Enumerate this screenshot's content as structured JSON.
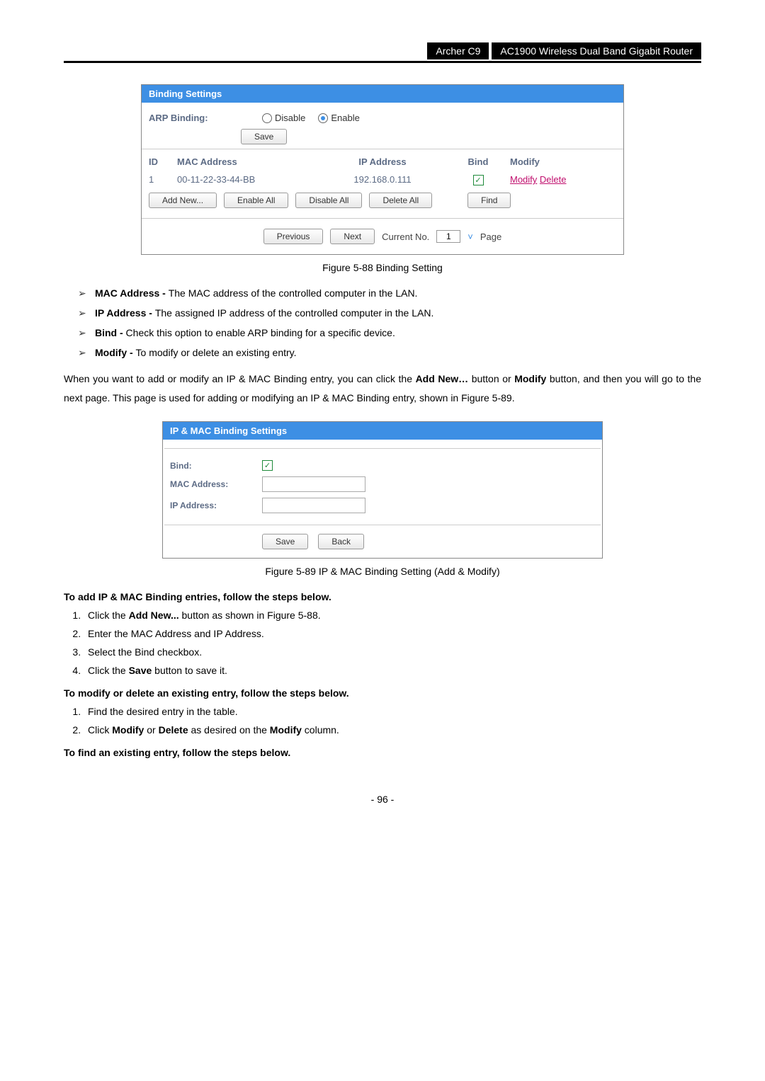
{
  "header": {
    "model": "Archer C9",
    "title": "AC1900 Wireless Dual Band Gigabit Router"
  },
  "screenshot1": {
    "title": "Binding Settings",
    "arpLabel": "ARP Binding:",
    "disable": "Disable",
    "enable": "Enable",
    "save": "Save",
    "cols": {
      "id": "ID",
      "mac": "MAC Address",
      "ip": "IP Address",
      "bind": "Bind",
      "modify": "Modify"
    },
    "row": {
      "id": "1",
      "mac": "00-11-22-33-44-BB",
      "ip": "192.168.0.111",
      "modify": "Modify",
      "delete": "Delete"
    },
    "btns": {
      "addNew": "Add New...",
      "enableAll": "Enable All",
      "disableAll": "Disable All",
      "deleteAll": "Delete All",
      "find": "Find"
    },
    "pager": {
      "previous": "Previous",
      "next": "Next",
      "currentLabel": "Current No.",
      "currentVal": "1",
      "pageLabel": "Page"
    }
  },
  "fig1": "Figure 5-88 Binding Setting",
  "bullets": {
    "mac": {
      "term": "MAC Address - ",
      "desc": "The MAC address of the controlled computer in the LAN."
    },
    "ip": {
      "term": "IP Address - ",
      "desc": "The assigned IP address of the controlled computer in the LAN."
    },
    "bind": {
      "term": "Bind - ",
      "desc": "Check this option to enable ARP binding for a specific device."
    },
    "mod": {
      "term": "Modify - ",
      "desc": "To modify or delete an existing entry."
    }
  },
  "para1": {
    "p1": "When you want to add or modify an IP & MAC Binding entry, you can click the ",
    "addNew": "Add New…",
    "p2": " button or ",
    "modify": "Modify",
    "p3": " button, and then you will go to the next page. This page is used for adding or modifying an IP & MAC Binding entry, shown in ",
    "figref": "Figure 5-89",
    "p4": "."
  },
  "screenshot2": {
    "title": "IP & MAC Binding Settings",
    "bind": "Bind:",
    "mac": "MAC Address:",
    "ip": "IP Address:",
    "save": "Save",
    "back": "Back"
  },
  "fig2": "Figure 5-89 IP & MAC Binding Setting (Add & Modify)",
  "addHead": "To add IP & MAC Binding entries, follow the steps below.",
  "addSteps": {
    "s1a": "Click the ",
    "s1b": "Add New...",
    "s1c": " button as shown in ",
    "s1d": "Figure 5-88",
    "s1e": ".",
    "s2": "Enter the MAC Address and IP Address.",
    "s3": "Select the Bind checkbox.",
    "s4a": "Click the ",
    "s4b": "Save",
    "s4c": " button to save it."
  },
  "modHead": "To modify or delete an existing entry, follow the steps below.",
  "modSteps": {
    "s1": "Find the desired entry in the table.",
    "s2a": "Click ",
    "s2b": "Modify",
    "s2c": " or ",
    "s2d": "Delete",
    "s2e": " as desired on the ",
    "s2f": "Modify",
    "s2g": " column."
  },
  "findHead": "To find an existing entry, follow the steps below.",
  "pagenum": "- 96 -"
}
